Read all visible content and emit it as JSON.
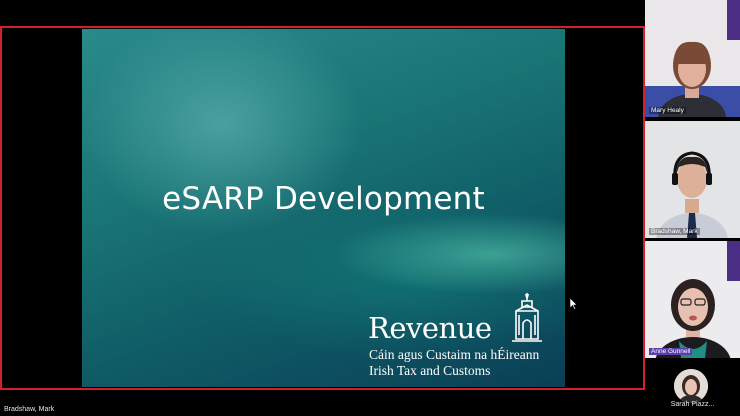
{
  "slide": {
    "title": "eSARP Development",
    "logo_name": "Revenue",
    "logo_line1": "Cáin agus Custaim na hÉireann",
    "logo_line2": "Irish Tax and Customs"
  },
  "stage": {
    "presenter_label": "Bradshaw, Mark"
  },
  "participants": [
    {
      "name": "Mary Healy",
      "active": false
    },
    {
      "name": "Bradshaw, Mark",
      "active": false
    },
    {
      "name": "Anne Gunnell",
      "active": true
    }
  ],
  "thumbnail": {
    "name": "Sarah Piazz..."
  },
  "colors": {
    "active_border": "#d21f2c",
    "slide_teal": "#1a7676",
    "label_active": "#5b3fa8"
  }
}
